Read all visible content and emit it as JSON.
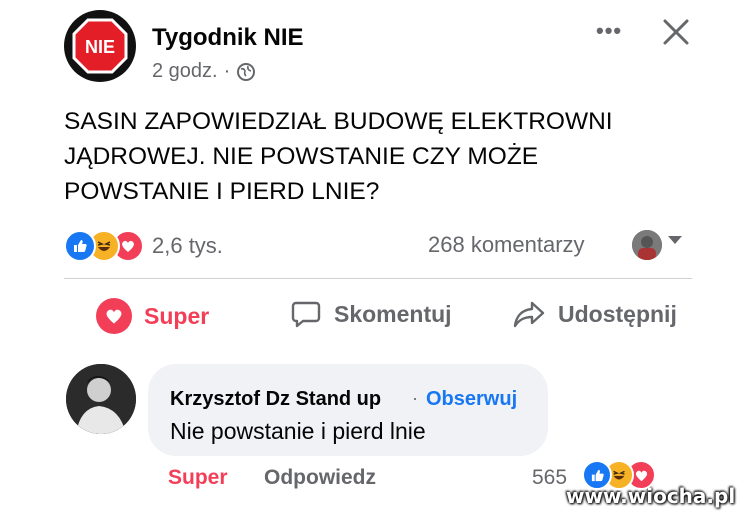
{
  "post": {
    "page_name": "Tygodnik NIE",
    "page_logo_text": "NIE",
    "time": "2 godz.",
    "separator": "·",
    "text": "SASIN ZAPOWIEDZIAŁ BUDOWĘ ELEKTROWNI JĄDROWEJ. NIE POWSTANIE CZY MOŻE POWSTANIE I PIERD LNIE?",
    "more_label": "•••"
  },
  "stats": {
    "reactions": "2,6 tys.",
    "comments": "268 komentarzy"
  },
  "actions": {
    "super": "Super",
    "comment": "Skomentuj",
    "share": "Udostępnij"
  },
  "comment": {
    "author": "Krzysztof Dz Stand up",
    "dot": "·",
    "follow": "Obserwuj",
    "text": "Nie powstanie i pierd lnie",
    "super": "Super",
    "reply": "Odpowiedz",
    "reaction_count": "565"
  },
  "watermark": "www.wiocha.pl",
  "colors": {
    "like": "#1877f2",
    "love": "#f33e58",
    "haha": "#f7b125",
    "secondary_text": "#65676b"
  }
}
